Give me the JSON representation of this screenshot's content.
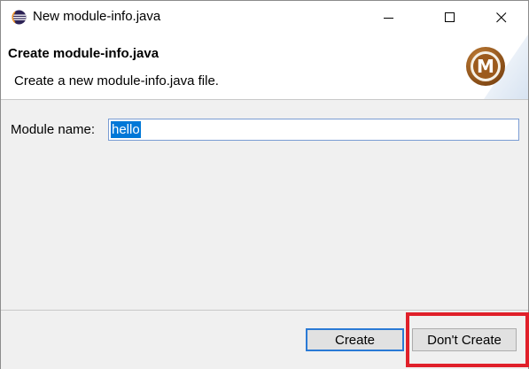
{
  "window": {
    "title": "New module-info.java",
    "controls": {
      "minimize": "minimize-icon",
      "maximize": "maximize-icon",
      "close": "close-icon"
    }
  },
  "banner": {
    "title": "Create module-info.java",
    "description": "Create a new module-info.java file.",
    "logo_letter": "M"
  },
  "form": {
    "module_label": "Module name:",
    "module_value": "hello"
  },
  "buttons": {
    "create": "Create",
    "dont_create": "Don't Create"
  },
  "colors": {
    "selection": "#0078d7",
    "default_button_border": "#2a7ad5",
    "highlight_box": "#e0202a",
    "logo": "#9c5a1c"
  }
}
